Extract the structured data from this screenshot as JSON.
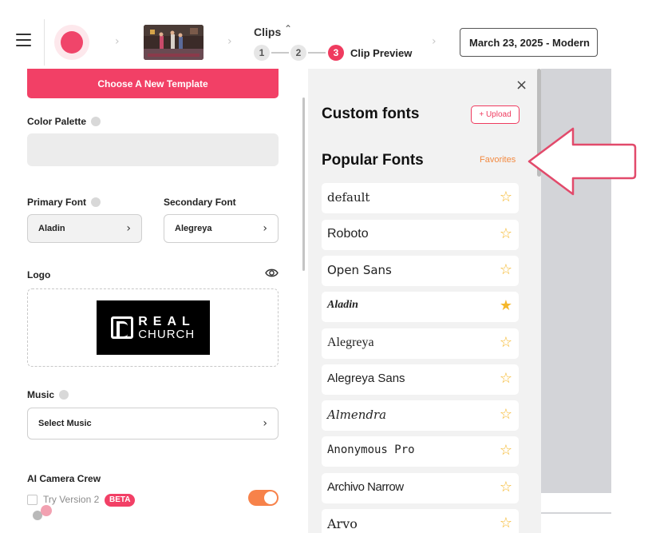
{
  "header": {
    "clips_label": "Clips",
    "steps": [
      "1",
      "2",
      "3"
    ],
    "active_step_label": "Clip Preview",
    "date_title": "March 23, 2025 - Modern"
  },
  "left_panel": {
    "choose_template": "Choose A New Template",
    "color_palette_label": "Color Palette",
    "primary_font_label": "Primary Font",
    "primary_font_value": "Aladin",
    "secondary_font_label": "Secondary Font",
    "secondary_font_value": "Alegreya",
    "logo_label": "Logo",
    "logo_text_line1": "REAL",
    "logo_text_line2": "CHURCH",
    "music_label": "Music",
    "music_placeholder": "Select Music",
    "ai_camera_label": "AI Camera Crew",
    "try_version": "Try Version 2",
    "beta_badge": "BETA",
    "toggle_on": true
  },
  "font_panel": {
    "custom_title": "Custom fonts",
    "upload_label": "+ Upload",
    "popular_title": "Popular Fonts",
    "favorites_label": "Favorites",
    "fonts": [
      {
        "name": "default",
        "favorite": false
      },
      {
        "name": "Roboto",
        "favorite": false
      },
      {
        "name": "Open Sans",
        "favorite": false
      },
      {
        "name": "Aladin",
        "favorite": true
      },
      {
        "name": "Alegreya",
        "favorite": false
      },
      {
        "name": "Alegreya Sans",
        "favorite": false
      },
      {
        "name": "Almendra",
        "favorite": false
      },
      {
        "name": "Anonymous Pro",
        "favorite": false
      },
      {
        "name": "Archivo Narrow",
        "favorite": false
      },
      {
        "name": "Arvo",
        "favorite": false
      }
    ]
  },
  "colors": {
    "accent": "#f24066",
    "favorites": "#f38a41",
    "toggle": "#f7824a",
    "star": "#f5b72a",
    "annotation_arrow": "#e24a6b"
  },
  "icons": {
    "menu": "hamburger-icon",
    "record": "record-icon",
    "close": "close-icon",
    "visibility": "eye-icon",
    "star": "star-icon"
  }
}
